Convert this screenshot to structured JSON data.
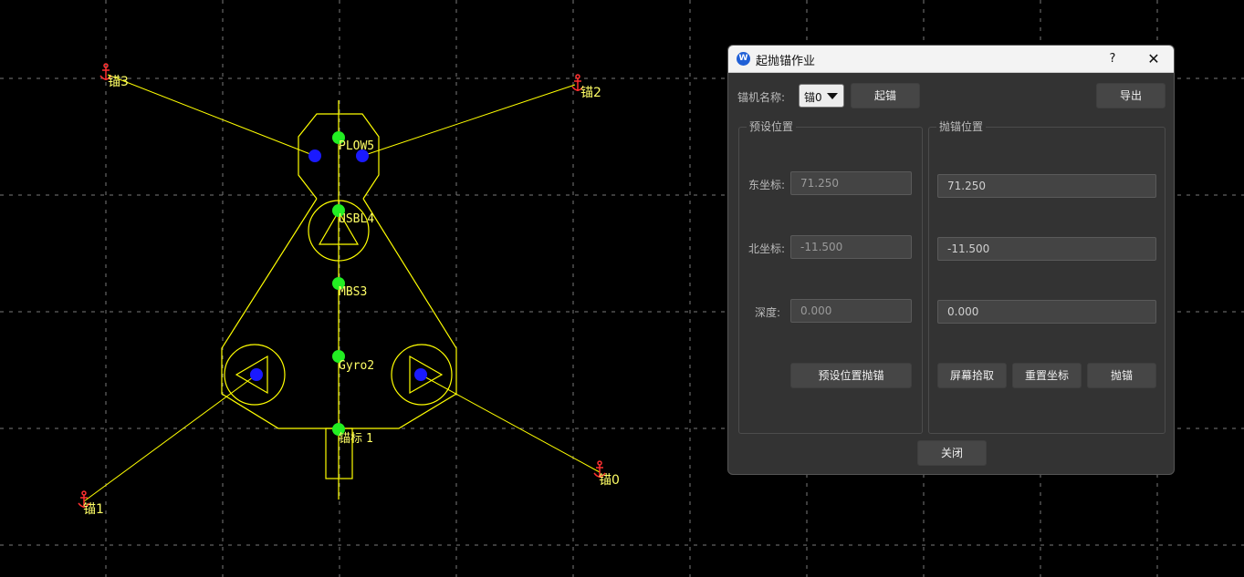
{
  "canvas": {
    "grid_color": "#7a7a7a",
    "line_color": "#ffff00",
    "sensor_color": "#22ee22",
    "thruster_color": "#1a1aff",
    "anchor_color": "#ff3030",
    "sensors": [
      "PLOW5",
      "USBL4",
      "MBS3",
      "Gyro2",
      "锚标",
      "1"
    ],
    "anchors": [
      "锚0",
      "锚1",
      "锚2",
      "锚3"
    ]
  },
  "dialog": {
    "title": "起抛锚作业",
    "help": "?",
    "close_icon": "✕",
    "winch_label": "锚机名称:",
    "winch_selected": "锚0",
    "raise_button": "起锚",
    "export_button": "导出",
    "preset": {
      "title": "预设位置",
      "east_label": "东坐标:",
      "east_value": "71.250",
      "north_label": "北坐标:",
      "north_value": "-11.500",
      "depth_label": "深度:",
      "depth_value": "0.000",
      "drop_button": "预设位置抛锚"
    },
    "drop": {
      "title": "抛锚位置",
      "east_value": "71.250",
      "north_value": "-11.500",
      "depth_value": "0.000",
      "pick_button": "屏幕拾取",
      "reset_button": "重置坐标",
      "drop_button": "抛锚"
    },
    "close_button": "关闭"
  }
}
